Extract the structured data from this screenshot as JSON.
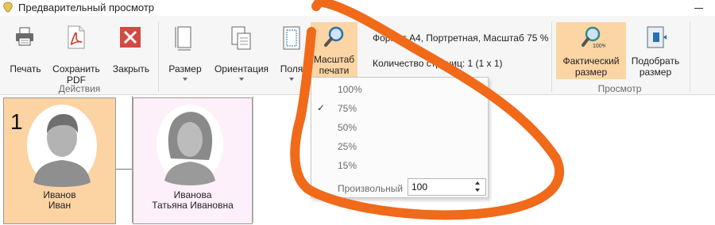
{
  "window": {
    "title": "Предварительный просмотр"
  },
  "ribbon": {
    "groups": {
      "actions": "Действия",
      "view": "Просмотр"
    },
    "print_label": "Печать",
    "save_pdf_label": "Сохранить\nPDF",
    "close_label": "Закрыть",
    "size_label": "Размер",
    "orientation_label": "Ориентация",
    "margins_label": "Поля",
    "zoom_label": "Масштаб\nпечати",
    "actual_size_label": "Фактический\nразмер",
    "fit_size_label": "Подобрать\nразмер",
    "page_info": "Формат А4, Портретная, Масштаб 75 %",
    "page_count": "Количество страниц: 1 (1 x 1)"
  },
  "zoom_menu": {
    "options": [
      "100%",
      "75%",
      "50%",
      "25%",
      "15%"
    ],
    "selected": "75%",
    "custom_label": "Произвольный",
    "custom_value": "100"
  },
  "cards": [
    {
      "number": "1",
      "name": "Иванов\nИван",
      "color": "#fcd3a3"
    },
    {
      "number": "",
      "name": "Иванова\nТатьяна Ивановна",
      "color": "#fdf0fb"
    }
  ],
  "colors": {
    "highlight": "#fbd5a4",
    "annotation": "#f06a1a",
    "pdf_red": "#d9322a",
    "close_red": "#d24a43",
    "icon_blue": "#2a6fb0"
  }
}
